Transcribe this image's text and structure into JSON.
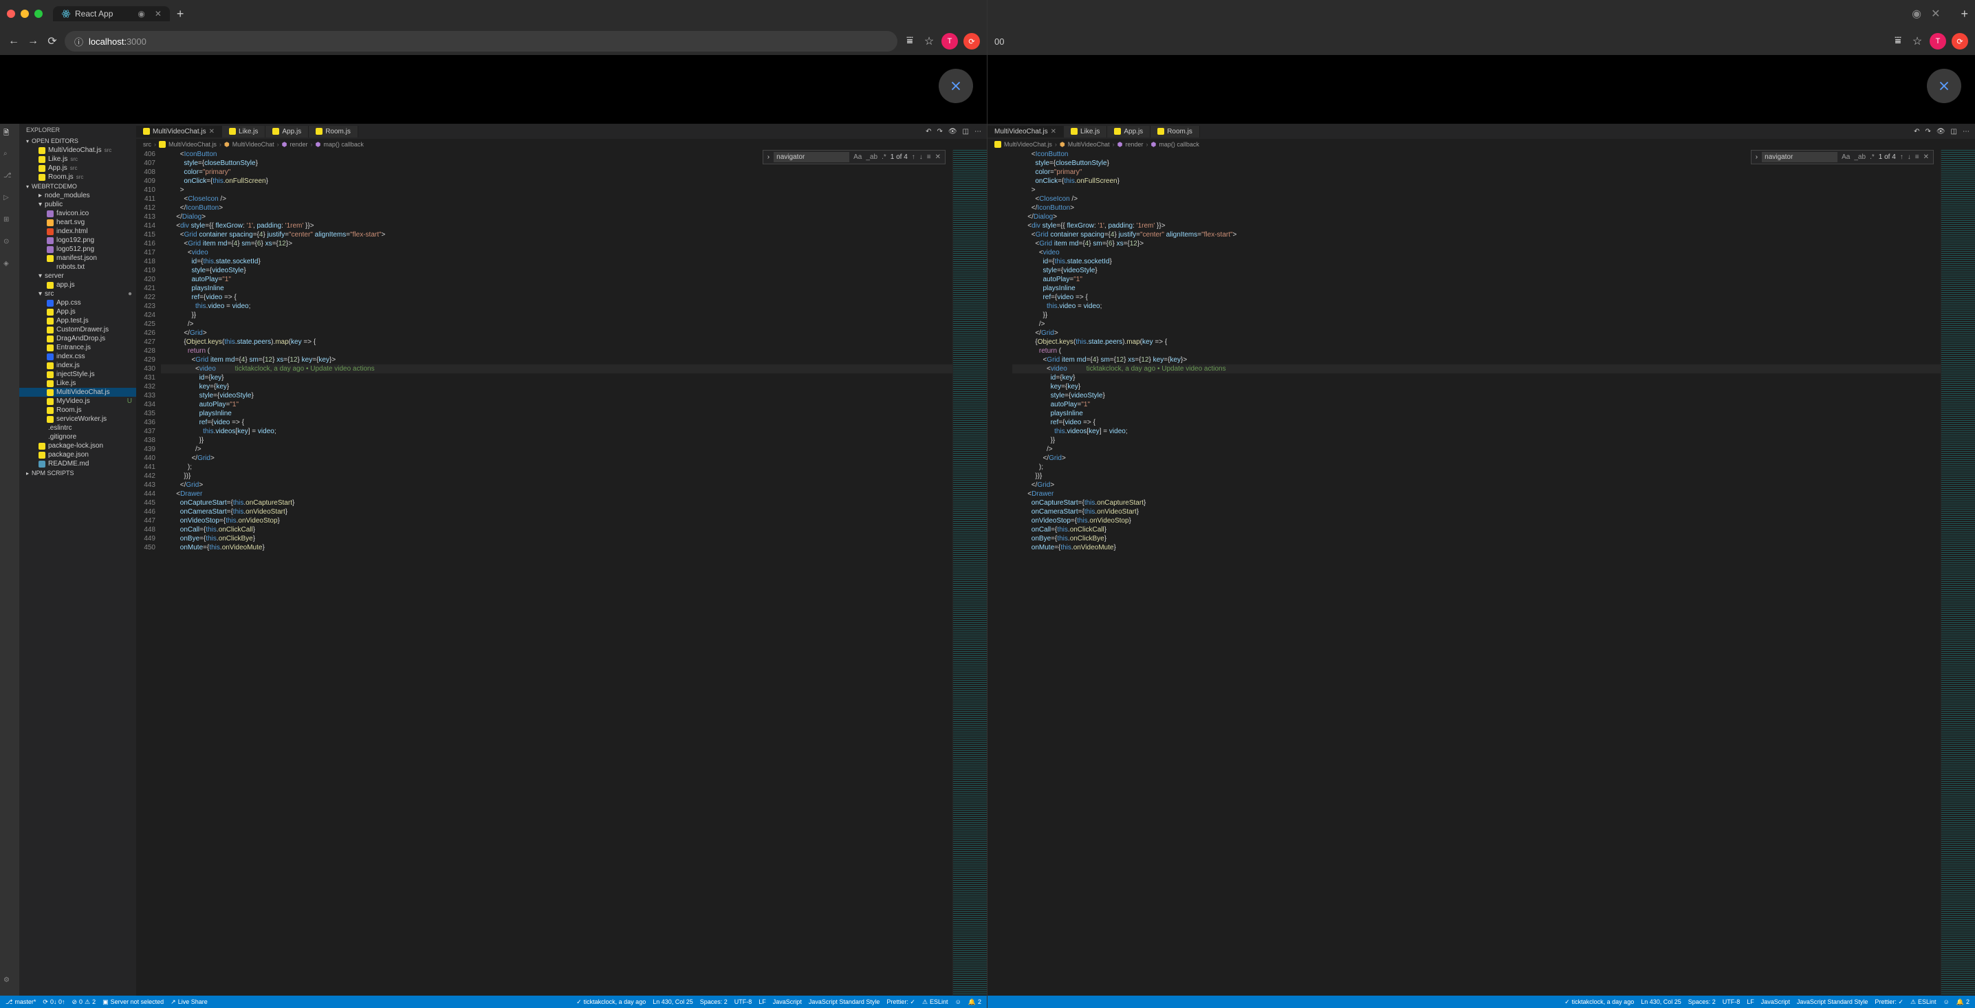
{
  "browser": {
    "tab_title": "React App",
    "url_host": "localhost:",
    "url_port": "3000",
    "avatar_letter": "T"
  },
  "vscode": {
    "explorer_title": "EXPLORER",
    "sections": {
      "open_editors": "OPEN EDITORS",
      "project": "WEBRTCDEMO",
      "npm_scripts": "NPM SCRIPTS"
    },
    "open_editors": [
      {
        "name": "MultiVideoChat.js",
        "path": "src"
      },
      {
        "name": "Like.js",
        "path": "src"
      },
      {
        "name": "App.js",
        "path": "src"
      },
      {
        "name": "Room.js",
        "path": "src"
      }
    ],
    "tree": {
      "node_modules": "node_modules",
      "public": "public",
      "public_items": [
        "favicon.ico",
        "heart.svg",
        "index.html",
        "logo192.png",
        "logo512.png",
        "manifest.json",
        "robots.txt"
      ],
      "server": "server",
      "server_items": [
        "app.js"
      ],
      "src": "src",
      "src_items": [
        "App.css",
        "App.js",
        "App.test.js",
        "CustomDrawer.js",
        "DragAndDrop.js",
        "Entrance.js",
        "index.css",
        "index.js",
        "injectStyle.js",
        "Like.js",
        "MultiVideoChat.js",
        "MyVideo.js",
        "Room.js",
        "serviceWorker.js"
      ],
      "root_items": [
        ".eslintrc",
        ".gitignore",
        "package-lock.json",
        "package.json",
        "README.md"
      ],
      "myvideo_badge": "U"
    },
    "tabs": [
      {
        "name": "MultiVideoChat.js",
        "active": true,
        "close": true
      },
      {
        "name": "Like.js"
      },
      {
        "name": "App.js"
      },
      {
        "name": "Room.js"
      }
    ],
    "breadcrumbs": [
      "src",
      "MultiVideoChat.js",
      "MultiVideoChat",
      "render",
      "map() callback"
    ],
    "find": {
      "value": "navigator",
      "result": "1 of 4"
    },
    "line_start": 406,
    "line_end": 449,
    "cursor_line": 430,
    "blame": "ticktakclock, a day ago • Update video actions",
    "status": {
      "branch": "master*",
      "sync": "0↓ 0↑",
      "errors": "0",
      "warnings": "2",
      "server": "Server not selected",
      "live_share": "Live Share",
      "blame": "ticktakclock, a day ago",
      "pos": "Ln 430, Col 25",
      "spaces": "Spaces: 2",
      "enc": "UTF-8",
      "eol": "LF",
      "lang": "JavaScript",
      "std": "JavaScript Standard Style",
      "prettier": "Prettier: ✓",
      "eslint": "ESLint",
      "bell": "2"
    }
  }
}
